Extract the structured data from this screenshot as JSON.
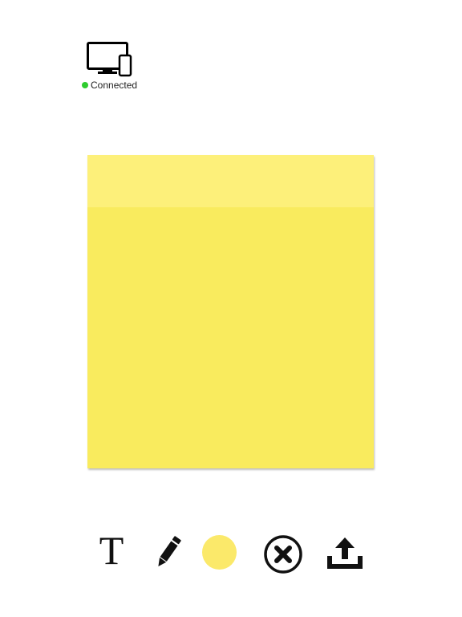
{
  "connection": {
    "status_text": "Connected",
    "status_color": "#2ecc2e",
    "device_icon": "desktop-and-phone-icon"
  },
  "note": {
    "header_color": "#fdf07a",
    "body_color": "#f9eb5e"
  },
  "toolbar": {
    "text_tool_glyph": "T",
    "text_tool_icon": "text-icon",
    "pencil_tool_icon": "pencil-icon",
    "color_tool_color": "#fbe96a",
    "delete_tool_icon": "close-circle-icon",
    "share_tool_icon": "upload-icon"
  }
}
